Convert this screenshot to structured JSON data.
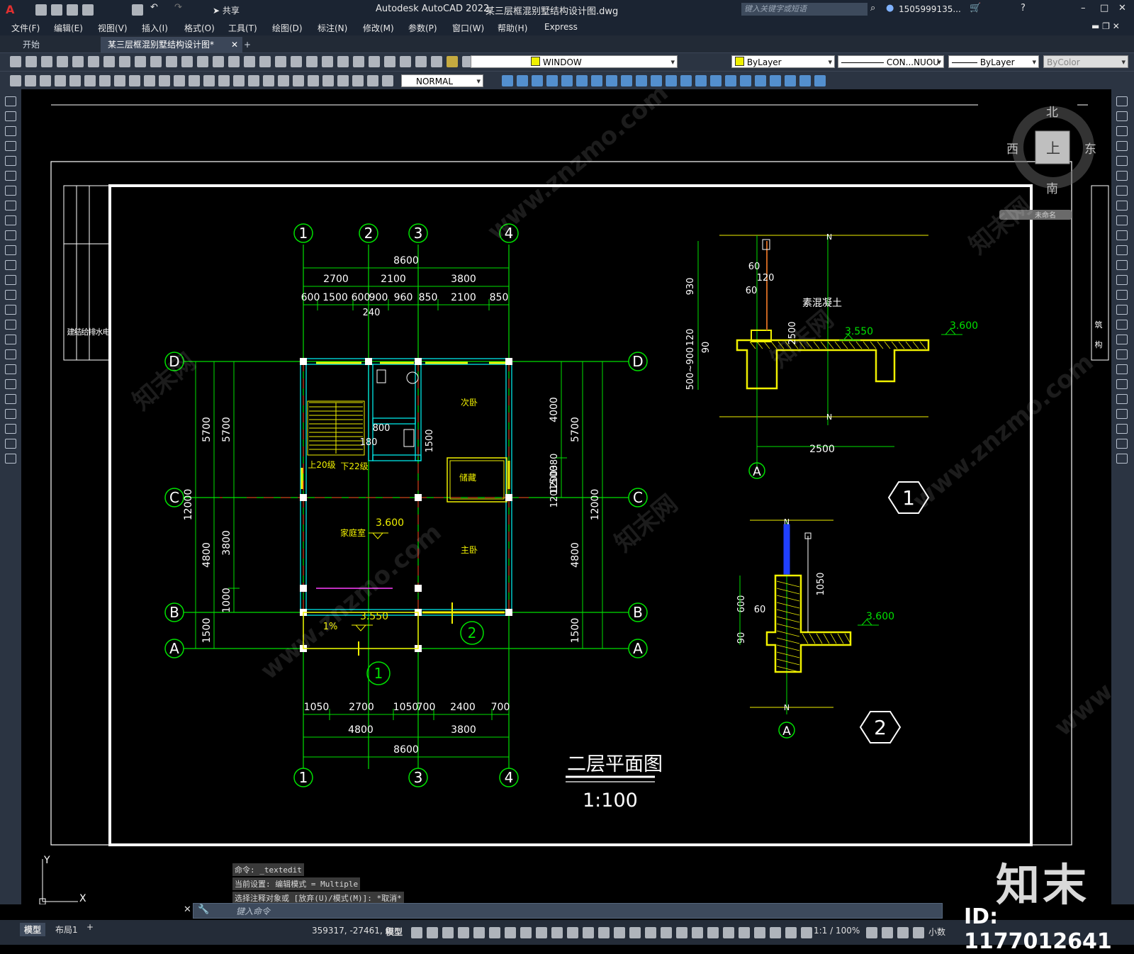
{
  "app": {
    "title": "Autodesk AutoCAD 2022",
    "file": "某三层框混别墅结构设计图.dwg",
    "share": "共享",
    "search_placeholder": "键入关键字或短语",
    "user": "1505999135...",
    "window_buttons": [
      "–",
      "□",
      "✕"
    ],
    "search_icon": "search-icon"
  },
  "menu": [
    "文件(F)",
    "编辑(E)",
    "视图(V)",
    "插入(I)",
    "格式(O)",
    "工具(T)",
    "绘图(D)",
    "标注(N)",
    "修改(M)",
    "参数(P)",
    "窗口(W)",
    "帮助(H)",
    "Express"
  ],
  "tabs": [
    {
      "label": "开始"
    },
    {
      "label": "某三层框混别墅结构设计图*"
    }
  ],
  "toolbar": {
    "layer": "WINDOW",
    "color": "ByLayer",
    "linetype": "CON...NUOU",
    "lineweight": "ByLayer",
    "plotstyle": "ByColor",
    "dimstyle": "NORMAL"
  },
  "viewcube": {
    "north": "北",
    "south": "南",
    "east": "东",
    "west": "西",
    "top": "上",
    "wcs": "未命名"
  },
  "drawing": {
    "title": "二层平面图",
    "scale": "1:100",
    "axes_top": [
      "1",
      "2",
      "3",
      "4"
    ],
    "axes_bottom": [
      "1",
      "3",
      "4"
    ],
    "axes_left": [
      "D",
      "C",
      "B",
      "A"
    ],
    "dims_top_total": "8600",
    "dims_top_row1": [
      "2700",
      "2100",
      "3800"
    ],
    "dims_top_row2": [
      "600",
      "1500",
      "600",
      "900",
      "960",
      "850",
      "2100",
      "850"
    ],
    "dim_240": "240",
    "dims_bottom_row1": [
      "1050",
      "2700",
      "1050",
      "700",
      "2400",
      "700"
    ],
    "dims_bottom_row2": [
      "4800",
      "3800"
    ],
    "dims_bottom_total": "8600",
    "dims_left_a": [
      "5700",
      "4800",
      "1500"
    ],
    "dims_left_b": [
      "5700",
      "3800",
      "1000"
    ],
    "dims_left_total": "12000",
    "dims_right_a": [
      "4000",
      "1500"
    ],
    "dims_right_b": [
      "5700",
      "4800",
      "1500"
    ],
    "dims_right_mid": [
      "380",
      "1200",
      "120"
    ],
    "dims_right_total": "12000",
    "dims_misc": [
      "800",
      "180",
      "1500"
    ],
    "rooms": [
      "次卧",
      "储藏",
      "家庭室",
      "主卧"
    ],
    "stairs": [
      "上20级",
      "下22级"
    ],
    "levels": [
      "3.600",
      "3.550"
    ],
    "slope": "1%",
    "section_marks": [
      "1",
      "2"
    ],
    "detail1": {
      "label": "素混凝土",
      "dims": [
        "930",
        "120",
        "90",
        "500~900",
        "60",
        "60",
        "120",
        "60",
        "120",
        "50",
        "2500"
      ],
      "levels": [
        "3.550",
        "3.600"
      ],
      "axis": "A",
      "n": "N",
      "number": "1"
    },
    "detail2": {
      "dims": [
        "600",
        "60",
        "90",
        "1050"
      ],
      "level": "3.600",
      "axis": "A",
      "n": "N",
      "number": "2"
    },
    "titleblock": [
      "建",
      "结",
      "给",
      "排",
      "水",
      "电",
      "气",
      "筑",
      "构"
    ]
  },
  "command": {
    "history": [
      "命令: _textedit",
      "当前设置: 编辑模式 = Multiple",
      "选择注释对象或 [放弃(U)/模式(M)]: *取消*"
    ],
    "placeholder": "键入命令"
  },
  "status": {
    "tabs": [
      "模型",
      "布局1"
    ],
    "coords": "359317, -27461, 0",
    "model": "模型",
    "scale": "1:1 / 100%",
    "units": "小数"
  },
  "watermark": {
    "logo": "知末",
    "id": "ID: 1177012641",
    "text": "www.znzmo.com",
    "cn": "知末网"
  },
  "colors": {
    "green": "#00e000",
    "yellow": "#f0f000",
    "cyan": "#00e8e8",
    "red": "#ff2020",
    "white": "#ffffff",
    "magenta": "#ff40ff",
    "blue": "#2040ff"
  }
}
